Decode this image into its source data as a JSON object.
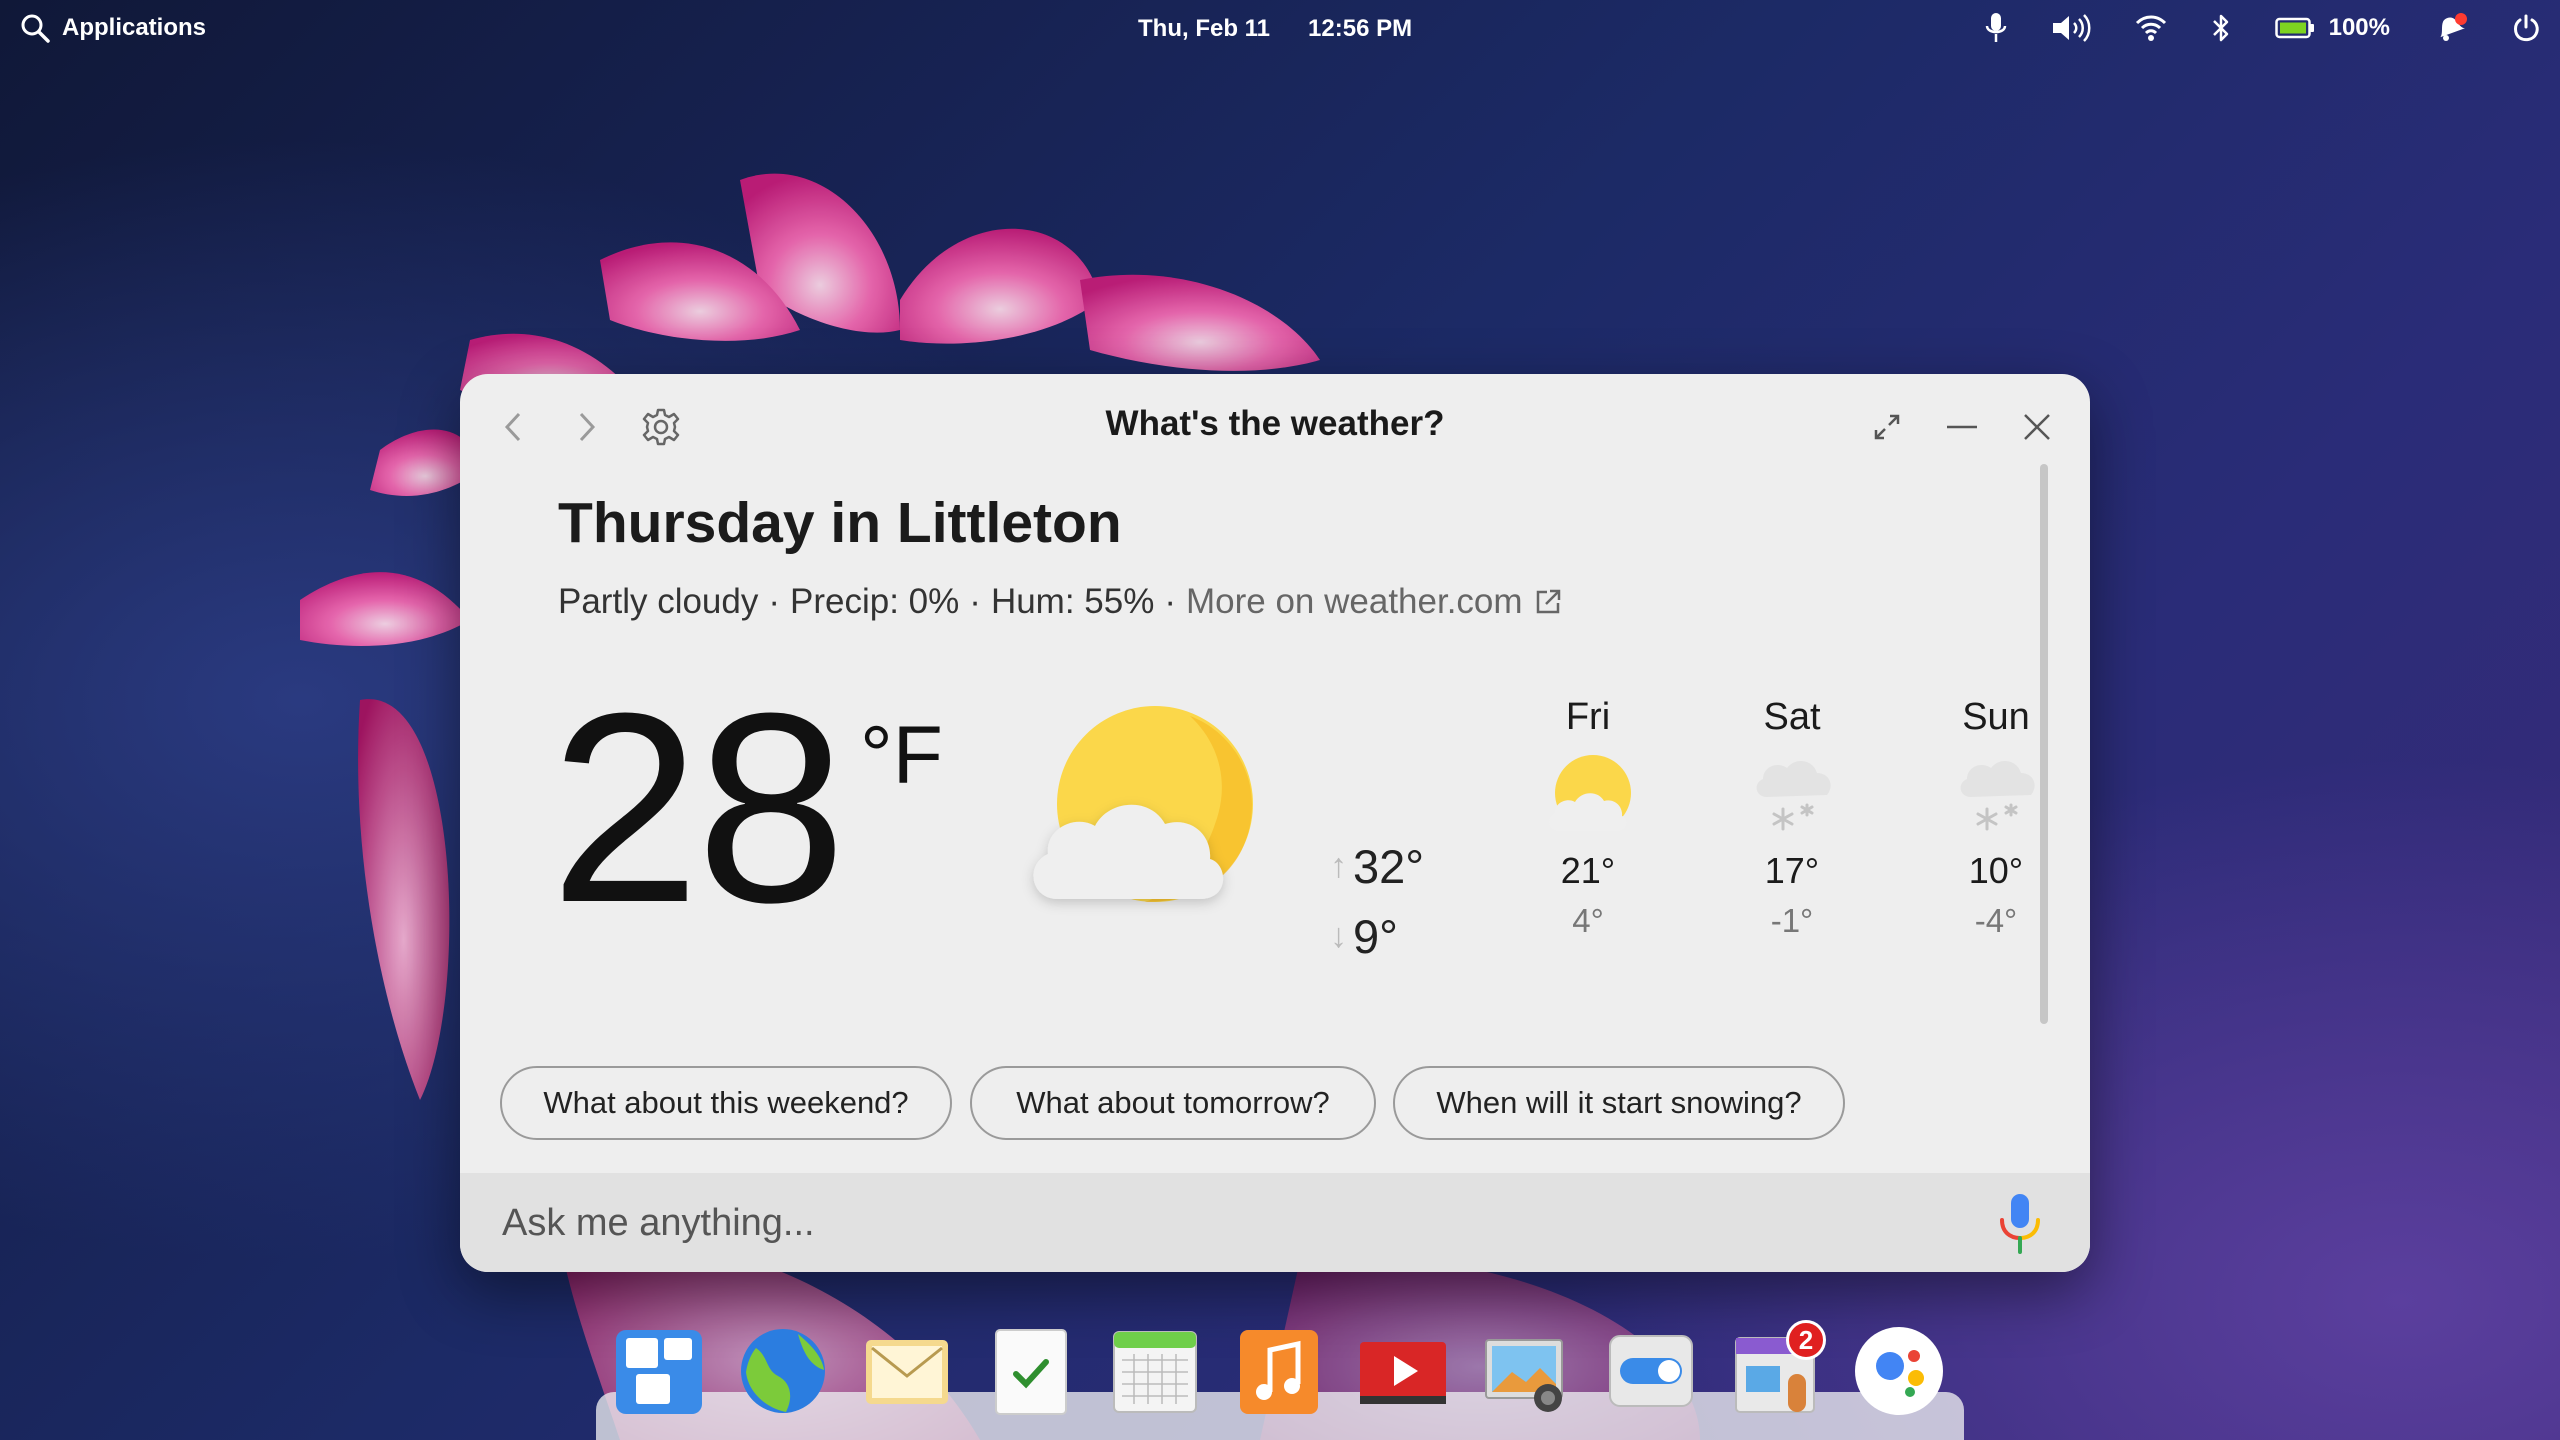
{
  "panel": {
    "applications_label": "Applications",
    "date": "Thu, Feb 11",
    "time": "12:56 PM",
    "battery_percent": "100%",
    "icons": [
      "microphone-icon",
      "volume-icon",
      "wifi-icon",
      "bluetooth-icon",
      "battery-icon",
      "notification-icon",
      "power-icon"
    ]
  },
  "window": {
    "title": "What's the weather?",
    "icons": [
      "back-icon",
      "forward-icon",
      "settings-icon",
      "expand-icon",
      "minimize-icon",
      "close-icon"
    ]
  },
  "weather": {
    "place": "Thursday in Littleton",
    "condition": "Partly cloudy",
    "precip": "Precip: 0%",
    "humidity": "Hum: 55%",
    "separator": "·",
    "more_link": "More on weather.com",
    "temperature": "28",
    "unit": "°F",
    "high": "32°",
    "low": "9°",
    "forecast": [
      {
        "day": "Fri",
        "high": "21°",
        "low": "4°",
        "icon": "partly-cloudy-icon"
      },
      {
        "day": "Sat",
        "high": "17°",
        "low": "-1°",
        "icon": "snow-icon"
      },
      {
        "day": "Sun",
        "high": "10°",
        "low": "-4°",
        "icon": "snow-icon"
      }
    ]
  },
  "suggestions": [
    "What about this weekend?",
    "What about tomorrow?",
    "When will it start snowing?"
  ],
  "ask": {
    "placeholder": "Ask me anything..."
  },
  "dock": {
    "apps": [
      "multitasking-view",
      "web-browser",
      "mail",
      "tasks",
      "calendar",
      "music",
      "videos",
      "photos",
      "system-settings",
      "app-center",
      "assistant"
    ],
    "app_center_badge": "2"
  },
  "colors": {
    "accent": "#4285f4",
    "sun": "#fbd74a",
    "window_bg": "#eeeeee"
  }
}
